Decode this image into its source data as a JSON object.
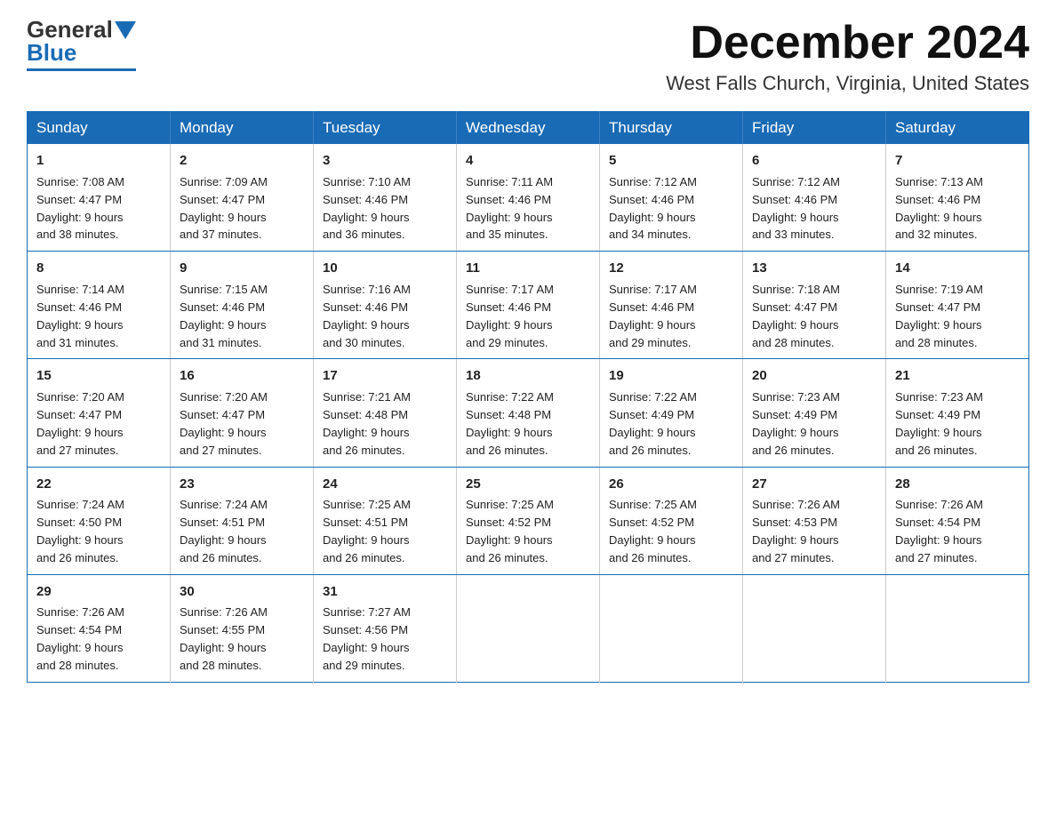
{
  "header": {
    "logo_general": "General",
    "logo_blue": "Blue",
    "main_title": "December 2024",
    "subtitle": "West Falls Church, Virginia, United States"
  },
  "days_of_week": [
    "Sunday",
    "Monday",
    "Tuesday",
    "Wednesday",
    "Thursday",
    "Friday",
    "Saturday"
  ],
  "weeks": [
    [
      {
        "day": "1",
        "sunrise": "7:08 AM",
        "sunset": "4:47 PM",
        "daylight": "9 hours and 38 minutes."
      },
      {
        "day": "2",
        "sunrise": "7:09 AM",
        "sunset": "4:47 PM",
        "daylight": "9 hours and 37 minutes."
      },
      {
        "day": "3",
        "sunrise": "7:10 AM",
        "sunset": "4:46 PM",
        "daylight": "9 hours and 36 minutes."
      },
      {
        "day": "4",
        "sunrise": "7:11 AM",
        "sunset": "4:46 PM",
        "daylight": "9 hours and 35 minutes."
      },
      {
        "day": "5",
        "sunrise": "7:12 AM",
        "sunset": "4:46 PM",
        "daylight": "9 hours and 34 minutes."
      },
      {
        "day": "6",
        "sunrise": "7:12 AM",
        "sunset": "4:46 PM",
        "daylight": "9 hours and 33 minutes."
      },
      {
        "day": "7",
        "sunrise": "7:13 AM",
        "sunset": "4:46 PM",
        "daylight": "9 hours and 32 minutes."
      }
    ],
    [
      {
        "day": "8",
        "sunrise": "7:14 AM",
        "sunset": "4:46 PM",
        "daylight": "9 hours and 31 minutes."
      },
      {
        "day": "9",
        "sunrise": "7:15 AM",
        "sunset": "4:46 PM",
        "daylight": "9 hours and 31 minutes."
      },
      {
        "day": "10",
        "sunrise": "7:16 AM",
        "sunset": "4:46 PM",
        "daylight": "9 hours and 30 minutes."
      },
      {
        "day": "11",
        "sunrise": "7:17 AM",
        "sunset": "4:46 PM",
        "daylight": "9 hours and 29 minutes."
      },
      {
        "day": "12",
        "sunrise": "7:17 AM",
        "sunset": "4:46 PM",
        "daylight": "9 hours and 29 minutes."
      },
      {
        "day": "13",
        "sunrise": "7:18 AM",
        "sunset": "4:47 PM",
        "daylight": "9 hours and 28 minutes."
      },
      {
        "day": "14",
        "sunrise": "7:19 AM",
        "sunset": "4:47 PM",
        "daylight": "9 hours and 28 minutes."
      }
    ],
    [
      {
        "day": "15",
        "sunrise": "7:20 AM",
        "sunset": "4:47 PM",
        "daylight": "9 hours and 27 minutes."
      },
      {
        "day": "16",
        "sunrise": "7:20 AM",
        "sunset": "4:47 PM",
        "daylight": "9 hours and 27 minutes."
      },
      {
        "day": "17",
        "sunrise": "7:21 AM",
        "sunset": "4:48 PM",
        "daylight": "9 hours and 26 minutes."
      },
      {
        "day": "18",
        "sunrise": "7:22 AM",
        "sunset": "4:48 PM",
        "daylight": "9 hours and 26 minutes."
      },
      {
        "day": "19",
        "sunrise": "7:22 AM",
        "sunset": "4:49 PM",
        "daylight": "9 hours and 26 minutes."
      },
      {
        "day": "20",
        "sunrise": "7:23 AM",
        "sunset": "4:49 PM",
        "daylight": "9 hours and 26 minutes."
      },
      {
        "day": "21",
        "sunrise": "7:23 AM",
        "sunset": "4:49 PM",
        "daylight": "9 hours and 26 minutes."
      }
    ],
    [
      {
        "day": "22",
        "sunrise": "7:24 AM",
        "sunset": "4:50 PM",
        "daylight": "9 hours and 26 minutes."
      },
      {
        "day": "23",
        "sunrise": "7:24 AM",
        "sunset": "4:51 PM",
        "daylight": "9 hours and 26 minutes."
      },
      {
        "day": "24",
        "sunrise": "7:25 AM",
        "sunset": "4:51 PM",
        "daylight": "9 hours and 26 minutes."
      },
      {
        "day": "25",
        "sunrise": "7:25 AM",
        "sunset": "4:52 PM",
        "daylight": "9 hours and 26 minutes."
      },
      {
        "day": "26",
        "sunrise": "7:25 AM",
        "sunset": "4:52 PM",
        "daylight": "9 hours and 26 minutes."
      },
      {
        "day": "27",
        "sunrise": "7:26 AM",
        "sunset": "4:53 PM",
        "daylight": "9 hours and 27 minutes."
      },
      {
        "day": "28",
        "sunrise": "7:26 AM",
        "sunset": "4:54 PM",
        "daylight": "9 hours and 27 minutes."
      }
    ],
    [
      {
        "day": "29",
        "sunrise": "7:26 AM",
        "sunset": "4:54 PM",
        "daylight": "9 hours and 28 minutes."
      },
      {
        "day": "30",
        "sunrise": "7:26 AM",
        "sunset": "4:55 PM",
        "daylight": "9 hours and 28 minutes."
      },
      {
        "day": "31",
        "sunrise": "7:27 AM",
        "sunset": "4:56 PM",
        "daylight": "9 hours and 29 minutes."
      },
      null,
      null,
      null,
      null
    ]
  ],
  "labels": {
    "sunrise": "Sunrise:",
    "sunset": "Sunset:",
    "daylight": "Daylight:"
  }
}
